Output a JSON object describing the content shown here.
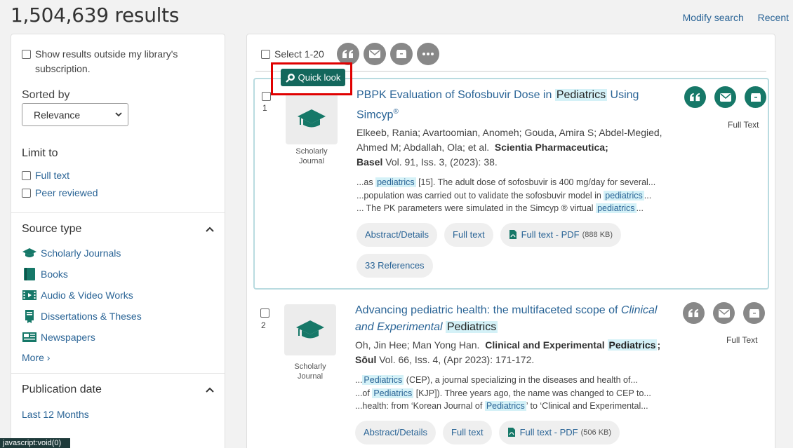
{
  "header": {
    "results_count": "1,504,639 results",
    "modify_search": "Modify search",
    "recent": "Recent"
  },
  "sidebar": {
    "show_outside": "Show results outside my library's subscription.",
    "sorted_by_label": "Sorted by",
    "sort_value": "Relevance",
    "limit_to": {
      "title": "Limit to",
      "full_text": "Full text",
      "peer_reviewed": "Peer reviewed"
    },
    "source_type": {
      "title": "Source type",
      "items": [
        "Scholarly Journals",
        "Books",
        "Audio & Video Works",
        "Dissertations & Theses",
        "Newspapers"
      ],
      "more": "More ›"
    },
    "publication_date": {
      "title": "Publication date",
      "first": "Last 12 Months"
    }
  },
  "toolbar": {
    "select_label": "Select 1-20",
    "quick_look": "Quick look"
  },
  "results": [
    {
      "num": "1",
      "type_label_1": "Scholarly",
      "type_label_2": "Journal",
      "title_pre": "PBPK Evaluation of Sofosbuvir Dose in ",
      "title_hl": "Pediatrics",
      "title_post": " Using Simcyp",
      "title_sup": "®",
      "authors": "Elkeeb, Rania; Avartoomian, Anomeh; Gouda, Amira S; Abdel-Megied, Ahmed M; Abdallah, Ola; et al.",
      "journal": "Scientia Pharmaceutica;",
      "place": "Basel",
      "details": " Vol. 91, Iss. 3,  (2023): 38.",
      "snippets": [
        {
          "pre": "...as ",
          "hl": "pediatrics",
          "post": " [15]. The adult dose of sofosbuvir is 400 mg/day for several..."
        },
        {
          "pre": "...population was carried out to validate the sofosbuvir model in ",
          "hl": "pediatrics",
          "post": "..."
        },
        {
          "pre": "... The PK parameters were simulated in the Simcyp ® virtual ",
          "hl": "pediatrics",
          "post": "..."
        }
      ],
      "abstract": "Abstract/Details",
      "full_text": "Full text",
      "pdf": "Full text - PDF",
      "pdf_size": "(888 KB)",
      "references": "33 References",
      "fulltext_label": "Full Text"
    },
    {
      "num": "2",
      "type_label_1": "Scholarly",
      "type_label_2": "Journal",
      "title_pre": "Advancing pediatric health: the multifaceted scope of ",
      "title_italic": "Clinical and Experimental",
      "title_hl": "Pediatrics",
      "authors_pre": "Oh, Jin Hee; Man Yong Han.",
      "journal_pre": "Clinical and Experimental ",
      "journal_hl": "Pediatrics",
      "journal_post": ";",
      "place": "Sōul",
      "details": " Vol. 66, Iss. 4,  (Apr 2023): 171-172.",
      "snippets": [
        {
          "pre": "...",
          "hl": "Pediatrics",
          "post": " (CEP), a journal specializing in the diseases and health of..."
        },
        {
          "pre": "...of ",
          "hl": "Pediatrics",
          "post": " [KJP]). Three years ago, the name was changed to CEP to..."
        },
        {
          "pre": "...health: from ‘Korean Journal of ",
          "hl": "Pediatrics",
          "post": "’ to ‘Clinical and Experimental..."
        }
      ],
      "abstract": "Abstract/Details",
      "full_text": "Full text",
      "pdf": "Full text - PDF",
      "pdf_size": "(506 KB)",
      "fulltext_label": "Full Text"
    }
  ],
  "status_bar": "javascript:void(0)",
  "colors": {
    "accent_green": "#167868",
    "link_blue": "#2a6496",
    "highlight": "#d4f1f7",
    "outline_red": "#e00000"
  }
}
